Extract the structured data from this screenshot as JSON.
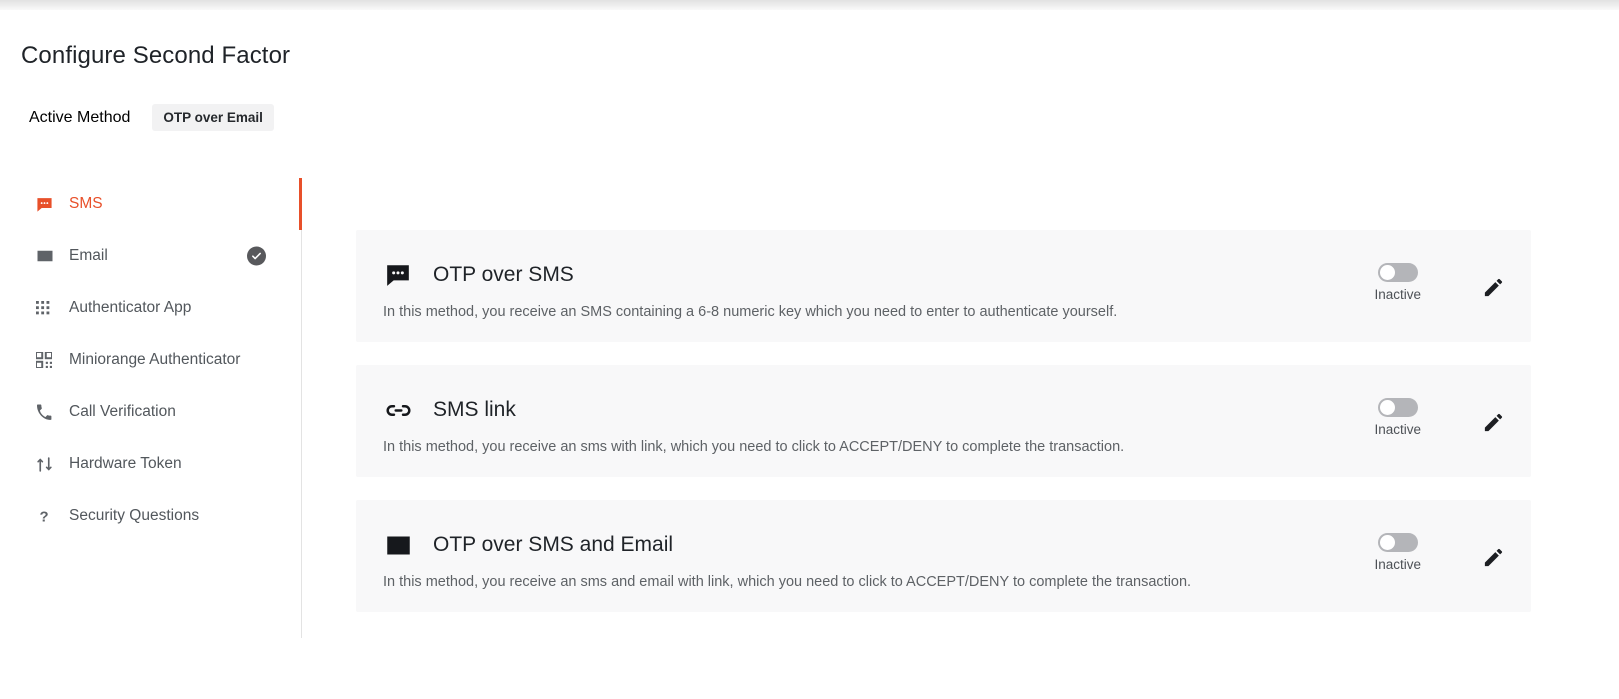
{
  "page": {
    "title": "Configure Second Factor",
    "active_method_label": "Active Method",
    "active_method_value": "OTP over Email"
  },
  "theme": {
    "accent": "#e8502a",
    "card_bg": "#f8f8f9",
    "toggle_off": "#b4b5b9",
    "text_primary": "#1f2328",
    "text_secondary": "#5e6266"
  },
  "sidebar": {
    "items": [
      {
        "label": "SMS",
        "icon": "sms-chat-icon",
        "active": true,
        "checked": false
      },
      {
        "label": "Email",
        "icon": "envelope-icon",
        "active": false,
        "checked": true
      },
      {
        "label": "Authenticator App",
        "icon": "dot-grid-icon",
        "active": false,
        "checked": false
      },
      {
        "label": "Miniorange Authenticator",
        "icon": "qr-code-icon",
        "active": false,
        "checked": false
      },
      {
        "label": "Call Verification",
        "icon": "phone-icon",
        "active": false,
        "checked": false
      },
      {
        "label": "Hardware Token",
        "icon": "hardware-token-icon",
        "active": false,
        "checked": false
      },
      {
        "label": "Security Questions",
        "icon": "question-mark-icon",
        "active": false,
        "checked": false
      }
    ]
  },
  "methods": [
    {
      "title": "OTP over SMS",
      "icon": "sms-chat-icon",
      "description": "In this method, you receive an SMS containing a 6-8 numeric key which you need to enter to authenticate yourself.",
      "status_label": "Inactive",
      "enabled": false,
      "edit_icon": "pencil-icon"
    },
    {
      "title": "SMS link",
      "icon": "link-icon",
      "description": "In this method, you receive an sms with link, which you need to click to ACCEPT/DENY to complete the transaction.",
      "status_label": "Inactive",
      "enabled": false,
      "edit_icon": "pencil-icon"
    },
    {
      "title": "OTP over SMS and Email",
      "icon": "envelope-icon",
      "description": "In this method, you receive an sms and email with link, which you need to click to ACCEPT/DENY to complete the transaction.",
      "status_label": "Inactive",
      "enabled": false,
      "edit_icon": "pencil-icon"
    }
  ]
}
